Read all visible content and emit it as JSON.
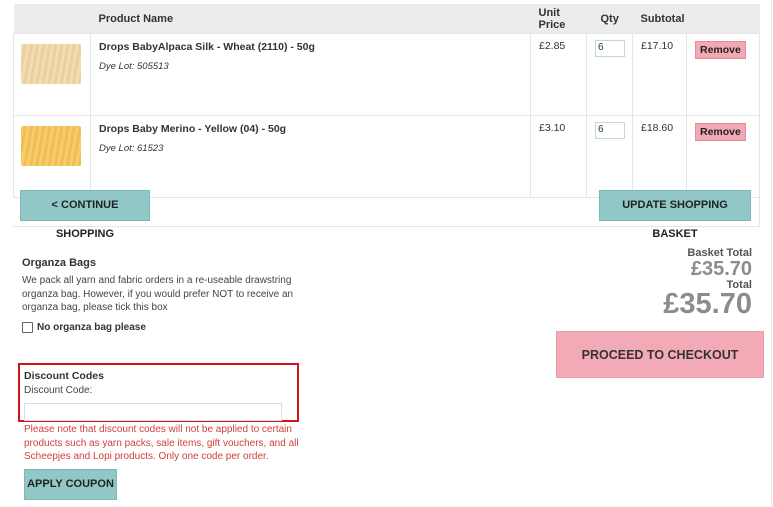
{
  "cart": {
    "headers": {
      "product_name": "Product Name",
      "unit_price": "Unit Price",
      "qty": "Qty",
      "subtotal": "Subtotal"
    },
    "items": [
      {
        "name": "Drops BabyAlpaca Silk - Wheat (2110) - 50g",
        "dye_lot": "Dye Lot: 505513",
        "unit_price": "£2.85",
        "qty": "6",
        "subtotal": "£17.10",
        "remove_label": "Remove",
        "swatch_color": "#f0d7a8"
      },
      {
        "name": "Drops Baby Merino - Yellow (04) - 50g",
        "dye_lot": "Dye Lot: 61523",
        "unit_price": "£3.10",
        "qty": "6",
        "subtotal": "£18.60",
        "remove_label": "Remove",
        "swatch_color": "#f5c865"
      }
    ],
    "continue_label": "< CONTINUE SHOPPING",
    "update_label": "UPDATE SHOPPING BASKET"
  },
  "organza": {
    "title": "Organza Bags",
    "text": "We pack all yarn and fabric orders in a re-useable drawstring organza bag. However, if you would prefer NOT to receive an organza bag, please tick this box",
    "checkbox_label": "No organza bag please"
  },
  "totals": {
    "basket_label": "Basket Total",
    "basket_value": "£35.70",
    "total_label": "Total",
    "total_value": "£35.70",
    "checkout_label": "PROCEED TO CHECKOUT"
  },
  "discount": {
    "title": "Discount Codes",
    "label": "Discount Code:",
    "value": "",
    "note": "Please note that discount codes will not be applied to certain products such as yarn packs, sale items, gift vouchers, and all Scheepjes and Lopi products. Only one code per order.",
    "apply_label": "APPLY COUPON"
  },
  "colors": {
    "teal_button": "#91c7c7",
    "pink_button": "#f2aab6",
    "highlight_border": "#d0161b",
    "note_text": "#d0403b"
  }
}
